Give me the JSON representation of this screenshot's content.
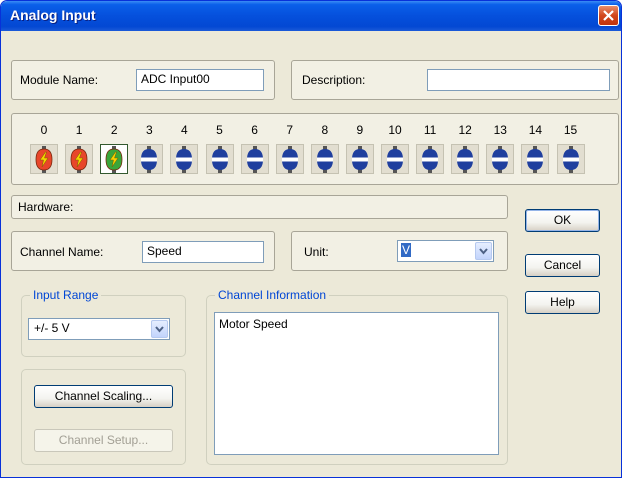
{
  "window": {
    "title": "Analog Input"
  },
  "module": {
    "name_label": "Module Name:",
    "name_value": "ADC Input00",
    "description_label": "Description:",
    "description_value": ""
  },
  "channels": [
    {
      "num": "0",
      "state": "active"
    },
    {
      "num": "1",
      "state": "active"
    },
    {
      "num": "2",
      "state": "selected"
    },
    {
      "num": "3",
      "state": "inactive"
    },
    {
      "num": "4",
      "state": "inactive"
    },
    {
      "num": "5",
      "state": "inactive"
    },
    {
      "num": "6",
      "state": "inactive"
    },
    {
      "num": "7",
      "state": "inactive"
    },
    {
      "num": "8",
      "state": "inactive"
    },
    {
      "num": "9",
      "state": "inactive"
    },
    {
      "num": "10",
      "state": "inactive"
    },
    {
      "num": "11",
      "state": "inactive"
    },
    {
      "num": "12",
      "state": "inactive"
    },
    {
      "num": "13",
      "state": "inactive"
    },
    {
      "num": "14",
      "state": "inactive"
    },
    {
      "num": "15",
      "state": "inactive"
    }
  ],
  "hardware": {
    "label": "Hardware:"
  },
  "channel": {
    "name_label": "Channel Name:",
    "name_value": "Speed",
    "unit_label": "Unit:",
    "unit_value": "V"
  },
  "input_range": {
    "title": "Input Range",
    "value": "+/- 5 V"
  },
  "buttons": {
    "ok": "OK",
    "cancel": "Cancel",
    "help": "Help",
    "scaling": "Channel Scaling...",
    "setup": "Channel Setup..."
  },
  "channel_info": {
    "title": "Channel Information",
    "text": "Motor Speed"
  },
  "colors": {
    "active_red": "#e8462a",
    "active_yellow": "#f5d400",
    "selected_green": "#3aa63a",
    "inactive_blue": "#1f3f9e",
    "group_title": "#0046d5"
  },
  "icons": {
    "channel": "plug-connector-icon",
    "lightning": "lightning-icon",
    "close": "close-icon",
    "dropdown": "chevron-down-icon"
  }
}
